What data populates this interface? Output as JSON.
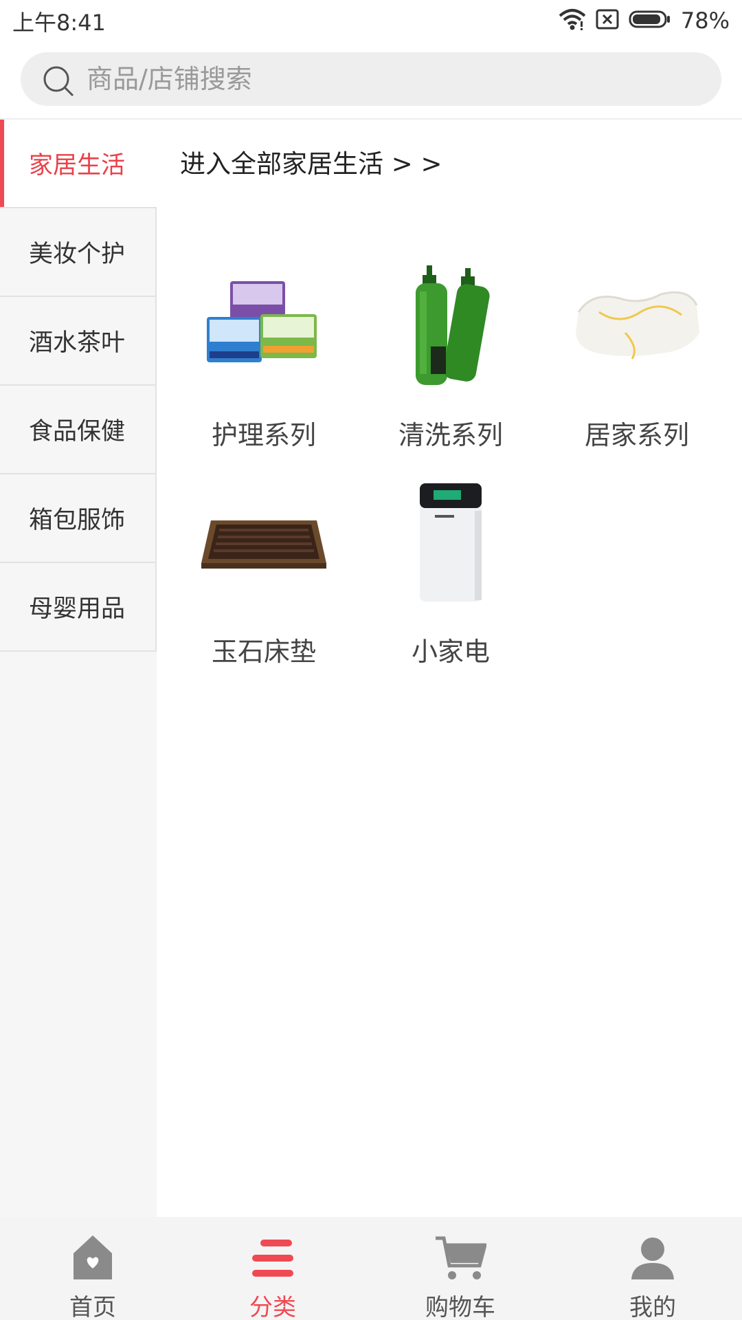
{
  "status_bar": {
    "time": "上午8:41",
    "battery_percent": "78%",
    "icons": [
      "wifi-icon",
      "sim-missing-icon",
      "battery-icon"
    ]
  },
  "search": {
    "placeholder": "商品/店铺搜索",
    "value": ""
  },
  "sidebar": {
    "items": [
      {
        "label": "家居生活",
        "active": true
      },
      {
        "label": "美妆个护"
      },
      {
        "label": "酒水茶叶"
      },
      {
        "label": "食品保健"
      },
      {
        "label": "箱包服饰"
      },
      {
        "label": "母婴用品"
      }
    ]
  },
  "content": {
    "enter_all_text": "进入全部家居生活 > >",
    "categories": [
      {
        "label": "护理系列",
        "icon": "pad-packages-image"
      },
      {
        "label": "清洗系列",
        "icon": "shampoo-bottles-image"
      },
      {
        "label": "居家系列",
        "icon": "latex-pillow-image"
      },
      {
        "label": "玉石床垫",
        "icon": "jade-mattress-image"
      },
      {
        "label": "小家电",
        "icon": "air-purifier-image"
      }
    ]
  },
  "tabbar": {
    "tabs": [
      {
        "label": "首页",
        "icon": "home-icon"
      },
      {
        "label": "分类",
        "icon": "category-icon",
        "active": true
      },
      {
        "label": "购物车",
        "icon": "cart-icon"
      },
      {
        "label": "我的",
        "icon": "user-icon"
      }
    ]
  },
  "colors": {
    "accent": "#ef4a53",
    "sidebar_bg": "#f6f6f6",
    "tabbar_bg": "#f4f4f4",
    "search_bg": "#eeeeee"
  }
}
